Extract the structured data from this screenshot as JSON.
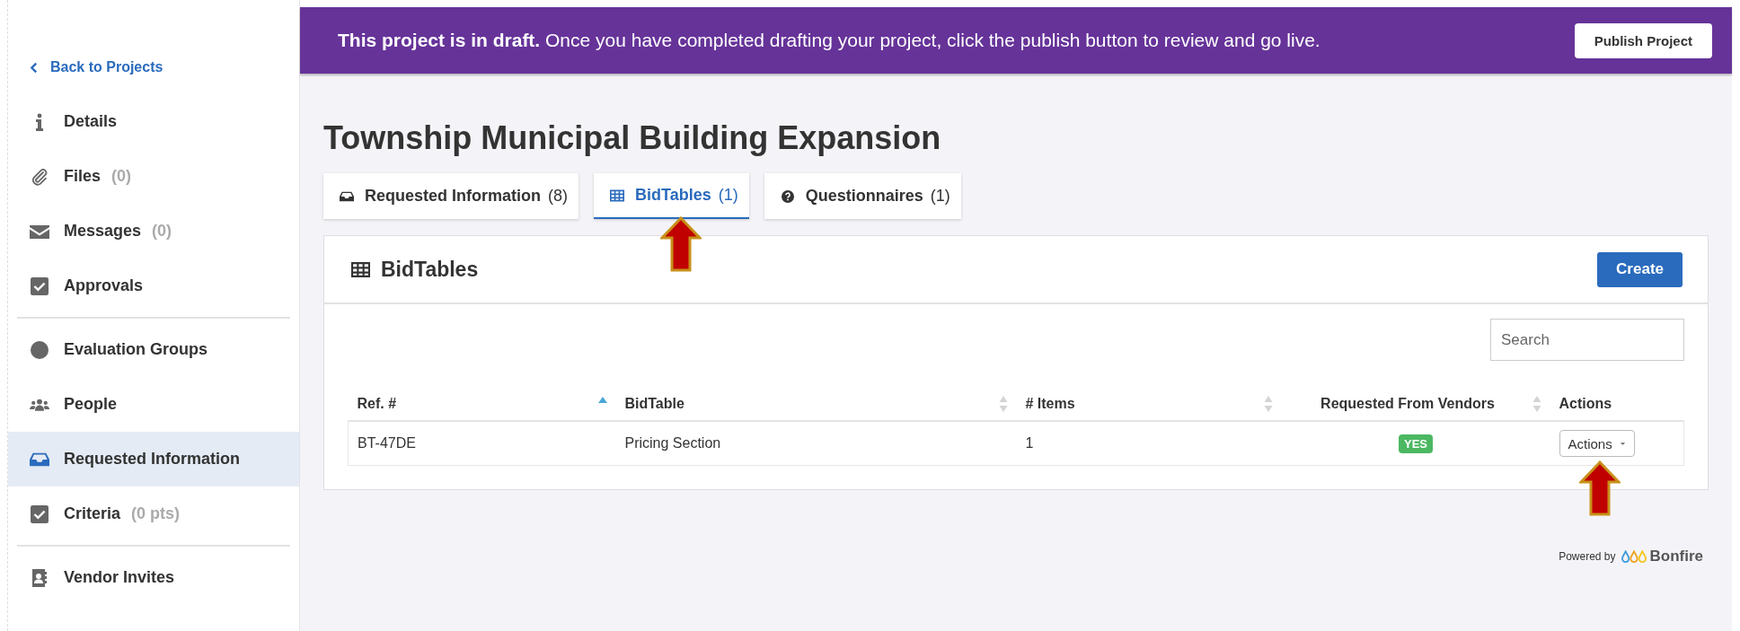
{
  "sidebar": {
    "back_link": {
      "label": "Back to Projects"
    },
    "sections": [
      {
        "items": [
          {
            "kind": "info",
            "label": "Details",
            "selected": false
          },
          {
            "kind": "paperclip",
            "label": "Files",
            "count": "(0)",
            "selected": false
          },
          {
            "kind": "envelope",
            "label": "Messages",
            "count": "(0)",
            "selected": false
          },
          {
            "kind": "check",
            "label": "Approvals",
            "selected": false
          }
        ]
      },
      {
        "items": [
          {
            "kind": "circle",
            "label": "Evaluation Groups",
            "selected": false
          },
          {
            "kind": "people",
            "label": "People",
            "selected": false
          },
          {
            "kind": "inbox",
            "label": "Requested Information",
            "selected": true
          },
          {
            "kind": "check",
            "label": "Criteria",
            "count": "(0 pts)",
            "selected": false
          }
        ]
      },
      {
        "items": [
          {
            "kind": "contact",
            "label": "Vendor Invites",
            "selected": false
          }
        ]
      }
    ]
  },
  "banner": {
    "text": "**This project is in draft.** Once you have completed drafting your project, click the publish button to review and go live.",
    "button": "Publish Project"
  },
  "page_title": "Township Municipal Building Expansion",
  "tabs": [
    {
      "kind": "inbox",
      "label": "Requested Information",
      "count": "(8)",
      "selected": false,
      "arrow": false
    },
    {
      "kind": "table",
      "label": "BidTables",
      "count": "(1)",
      "selected": true,
      "arrow": true
    },
    {
      "kind": "question",
      "label": "Questionnaires",
      "count": "(1)",
      "selected": false,
      "arrow": false
    }
  ],
  "panel": {
    "title": "BidTables",
    "create_button": "Create",
    "search": {
      "placeholder": "Search"
    },
    "table": {
      "columns": [
        {
          "label": "Ref. #",
          "sorted": true
        },
        {
          "label": "BidTable",
          "sorted": false
        },
        {
          "label": "# Items",
          "sorted": false
        },
        {
          "label": "Requested From Vendors",
          "sorted": false
        },
        {
          "label": "Actions"
        }
      ],
      "rows": [
        {
          "cells": [
            {
              "kind": "text",
              "text": "BT-47DE"
            },
            {
              "kind": "text",
              "text": "Pricing Section"
            },
            {
              "kind": "text",
              "text": "1"
            },
            {
              "kind": "badge",
              "text": "YES",
              "color": "#4cb862"
            },
            {
              "kind": "dropdown",
              "text": "Actions",
              "arrow": true
            }
          ]
        }
      ]
    }
  },
  "footer": {
    "powered_by": "Powered by",
    "brand": "Bonfire"
  }
}
